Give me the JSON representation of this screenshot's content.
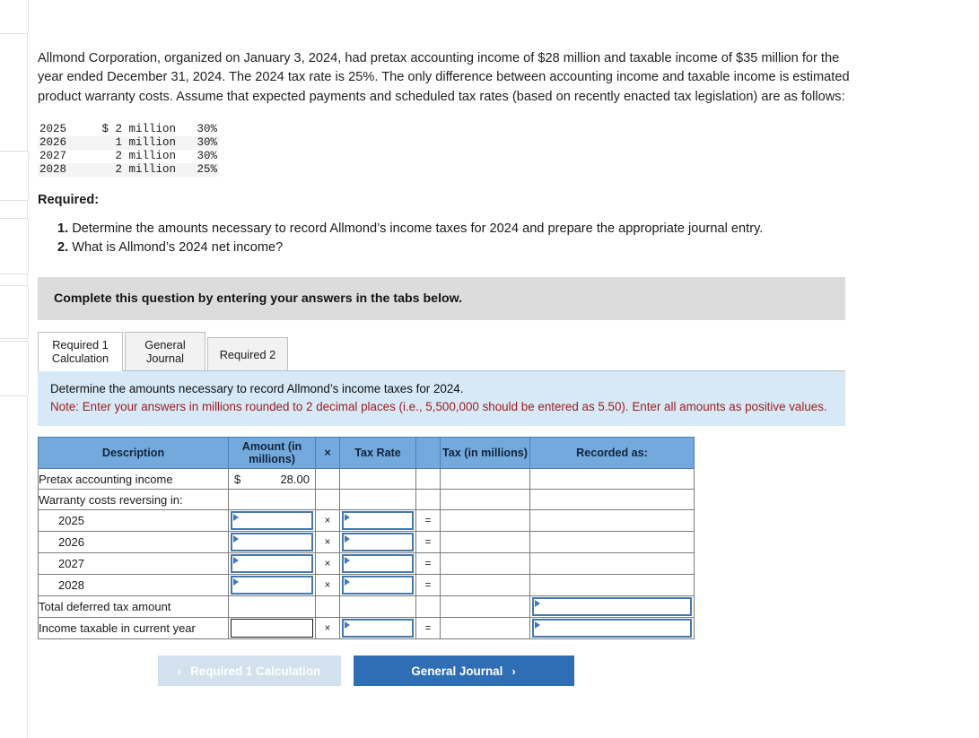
{
  "intro": {
    "paragraph": "Allmond Corporation, organized on January 3, 2024, had pretax accounting income of $28 million and taxable income of $35 million for the year ended December 31, 2024. The 2024 tax rate is 25%. The only difference between accounting income and taxable income is estimated product warranty costs. Assume that expected payments and scheduled tax rates (based on recently enacted tax legislation) are as follows:"
  },
  "schedule": {
    "rows": [
      {
        "year": "2025",
        "amount": "$ 2 million",
        "rate": "30%"
      },
      {
        "year": "2026",
        "amount": "1 million",
        "rate": "30%"
      },
      {
        "year": "2027",
        "amount": "2 million",
        "rate": "30%"
      },
      {
        "year": "2028",
        "amount": "2 million",
        "rate": "25%"
      }
    ]
  },
  "required": {
    "heading": "Required:",
    "items": [
      {
        "num": "1.",
        "text": "Determine the amounts necessary to record Allmond’s income taxes for 2024 and prepare the appropriate journal entry."
      },
      {
        "num": "2.",
        "text": "What is Allmond’s 2024 net income?"
      }
    ]
  },
  "banner": {
    "text": "Complete this question by entering your answers in the tabs below."
  },
  "tabs": [
    {
      "line1": "Required 1",
      "line2": "Calculation",
      "active": true
    },
    {
      "line1": "General",
      "line2": "Journal",
      "active": false
    },
    {
      "line1": "Required 2",
      "line2": "",
      "active": false
    }
  ],
  "note": {
    "title": "Determine the amounts necessary to record Allmond’s income taxes for 2024.",
    "warning": "Note: Enter your answers in millions rounded to 2 decimal places (i.e., 5,500,000 should be entered as 5.50). Enter all amounts as positive values."
  },
  "answer_table": {
    "headers": [
      "Description",
      "Amount (in millions)",
      "×",
      "Tax Rate",
      "",
      "Tax (in millions)",
      "Recorded as:"
    ],
    "rows": [
      {
        "description": "Pretax accounting income",
        "indent": false,
        "amount": {
          "kind": "money",
          "currency": "$",
          "value": "28.00"
        },
        "mul": "",
        "rate": {
          "kind": "empty"
        },
        "eq": "",
        "tax": {
          "kind": "empty"
        },
        "recorded": {
          "kind": "empty"
        }
      },
      {
        "description": "Warranty costs reversing in:",
        "indent": false,
        "amount": {
          "kind": "empty"
        },
        "mul": "",
        "rate": {
          "kind": "empty"
        },
        "eq": "",
        "tax": {
          "kind": "empty"
        },
        "recorded": {
          "kind": "empty"
        }
      },
      {
        "description": "2025",
        "indent": true,
        "amount": {
          "kind": "input",
          "value": ""
        },
        "mul": "×",
        "rate": {
          "kind": "input",
          "value": ""
        },
        "eq": "=",
        "tax": {
          "kind": "empty"
        },
        "recorded": {
          "kind": "empty"
        }
      },
      {
        "description": "2026",
        "indent": true,
        "amount": {
          "kind": "input",
          "value": ""
        },
        "mul": "×",
        "rate": {
          "kind": "input",
          "value": ""
        },
        "eq": "=",
        "tax": {
          "kind": "empty"
        },
        "recorded": {
          "kind": "empty"
        }
      },
      {
        "description": "2027",
        "indent": true,
        "amount": {
          "kind": "input",
          "value": ""
        },
        "mul": "×",
        "rate": {
          "kind": "input",
          "value": ""
        },
        "eq": "=",
        "tax": {
          "kind": "empty"
        },
        "recorded": {
          "kind": "empty"
        }
      },
      {
        "description": "2028",
        "indent": true,
        "amount": {
          "kind": "input",
          "value": ""
        },
        "mul": "×",
        "rate": {
          "kind": "input",
          "value": ""
        },
        "eq": "=",
        "tax": {
          "kind": "empty"
        },
        "recorded": {
          "kind": "empty"
        }
      },
      {
        "description": "Total deferred tax amount",
        "indent": false,
        "amount": {
          "kind": "empty"
        },
        "mul": "",
        "rate": {
          "kind": "empty"
        },
        "eq": "",
        "tax": {
          "kind": "empty"
        },
        "recorded": {
          "kind": "input",
          "value": ""
        }
      },
      {
        "description": "Income taxable in current year",
        "indent": false,
        "amount": {
          "kind": "input-plain",
          "value": ""
        },
        "mul": "×",
        "rate": {
          "kind": "input",
          "value": ""
        },
        "eq": "=",
        "tax": {
          "kind": "empty"
        },
        "recorded": {
          "kind": "input",
          "value": ""
        }
      }
    ]
  },
  "nav": {
    "prev_label": "Required 1 Calculation",
    "prev_chevron": "‹",
    "next_label": "General Journal",
    "next_chevron": "›"
  },
  "colors": {
    "header_blue": "#74a9dd",
    "note_blue": "#d7e9f7",
    "banner_gray": "#dcdcdc",
    "input_border": "#4579ad",
    "next_button": "#2f6eb5",
    "prev_button": "#d3e0ee",
    "warning_red": "#9b1c1c"
  }
}
